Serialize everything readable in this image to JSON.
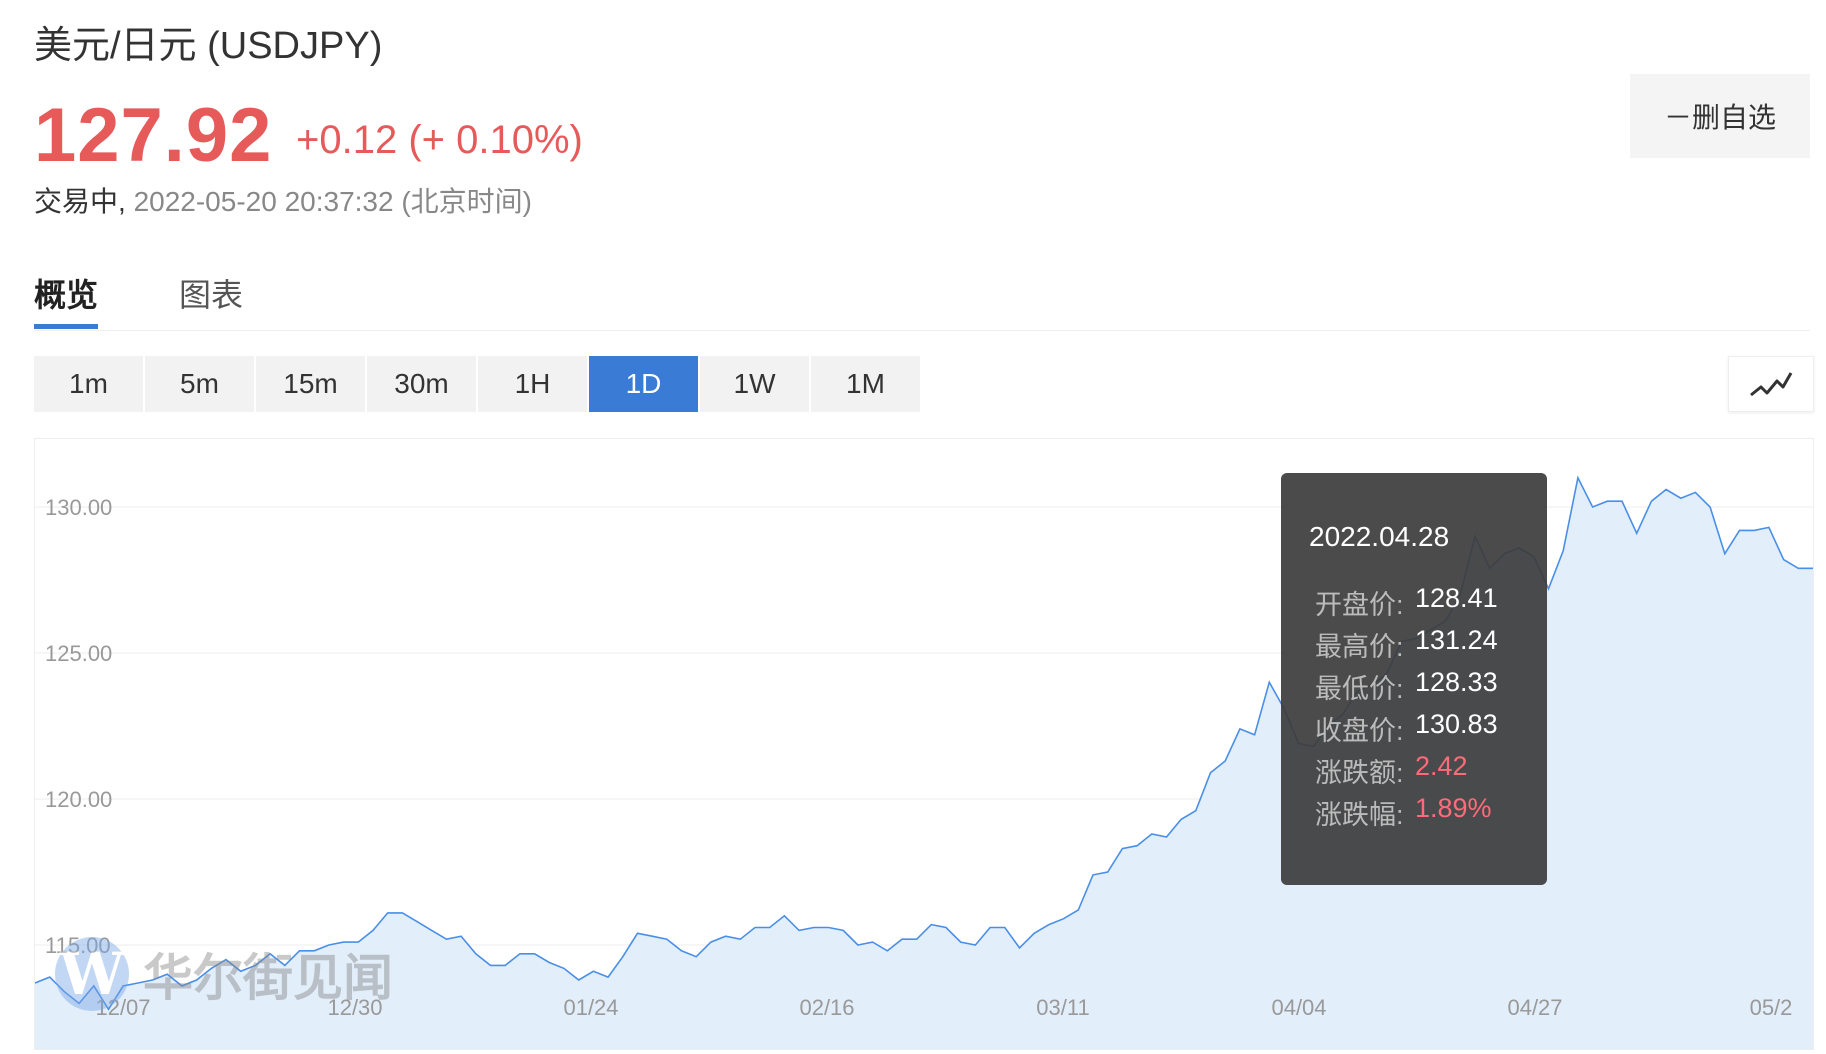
{
  "header": {
    "title": "美元/日元 (USDJPY)",
    "price": "127.92",
    "change": "+0.12 (+ 0.10%)",
    "status": "交易中,",
    "timestamp": "2022-05-20 20:37:32 (北京时间)"
  },
  "watch_button": "－删自选",
  "tabs": [
    {
      "label": "概览"
    },
    {
      "label": "图表"
    }
  ],
  "periods": [
    "1m",
    "5m",
    "15m",
    "30m",
    "1H",
    "1D",
    "1W",
    "1M"
  ],
  "active_period": "1D",
  "watermark": "华尔街见闻",
  "colors": {
    "accent": "#3a7bd5",
    "up": "#e65a5a",
    "line": "#4a8fe7",
    "fill": "#e3eefb"
  },
  "tooltip": {
    "date": "2022.04.28",
    "rows": [
      {
        "label": "开盘价:",
        "value": "128.41"
      },
      {
        "label": "最高价:",
        "value": "131.24"
      },
      {
        "label": "最低价:",
        "value": "128.33"
      },
      {
        "label": "收盘价:",
        "value": "130.83"
      },
      {
        "label": "涨跌额:",
        "value": "2.42"
      },
      {
        "label": "涨跌幅:",
        "value": "1.89%"
      }
    ]
  },
  "chart_data": {
    "type": "area",
    "y_ticks": [
      "115.00",
      "120.00",
      "125.00",
      "130.00"
    ],
    "x_ticks": [
      "12/07",
      "12/30",
      "01/24",
      "02/16",
      "03/11",
      "04/04",
      "04/27",
      "05/2"
    ],
    "ylim": [
      112.8,
      132.4
    ],
    "values": [
      113.7,
      113.9,
      113.4,
      113.0,
      113.6,
      112.8,
      113.6,
      113.7,
      113.8,
      114.0,
      113.6,
      113.8,
      114.2,
      114.5,
      114.1,
      114.3,
      114.7,
      114.3,
      114.8,
      114.8,
      115.0,
      115.1,
      115.1,
      115.5,
      116.1,
      116.1,
      115.8,
      115.5,
      115.2,
      115.3,
      114.7,
      114.3,
      114.3,
      114.7,
      114.7,
      114.4,
      114.2,
      113.8,
      114.1,
      113.9,
      114.6,
      115.4,
      115.3,
      115.2,
      114.8,
      114.6,
      115.1,
      115.3,
      115.2,
      115.6,
      115.6,
      116.0,
      115.5,
      115.6,
      115.6,
      115.5,
      115.0,
      115.1,
      114.8,
      115.2,
      115.2,
      115.7,
      115.6,
      115.1,
      115.0,
      115.6,
      115.6,
      114.9,
      115.4,
      115.7,
      115.9,
      116.2,
      117.4,
      117.5,
      118.3,
      118.4,
      118.8,
      118.7,
      119.3,
      119.6,
      120.9,
      121.3,
      122.4,
      122.2,
      124.0,
      123.1,
      121.9,
      121.8,
      122.5,
      122.9,
      123.7,
      123.9,
      124.3,
      125.4,
      125.5,
      125.8,
      126.1,
      127.0,
      129.0,
      127.9,
      128.4,
      128.6,
      128.3,
      127.2,
      128.5,
      131.0,
      130.0,
      130.2,
      130.2,
      129.1,
      130.2,
      130.6,
      130.3,
      130.5,
      130.0,
      128.4,
      129.2,
      129.2,
      129.3,
      128.2,
      127.9,
      127.9
    ]
  }
}
